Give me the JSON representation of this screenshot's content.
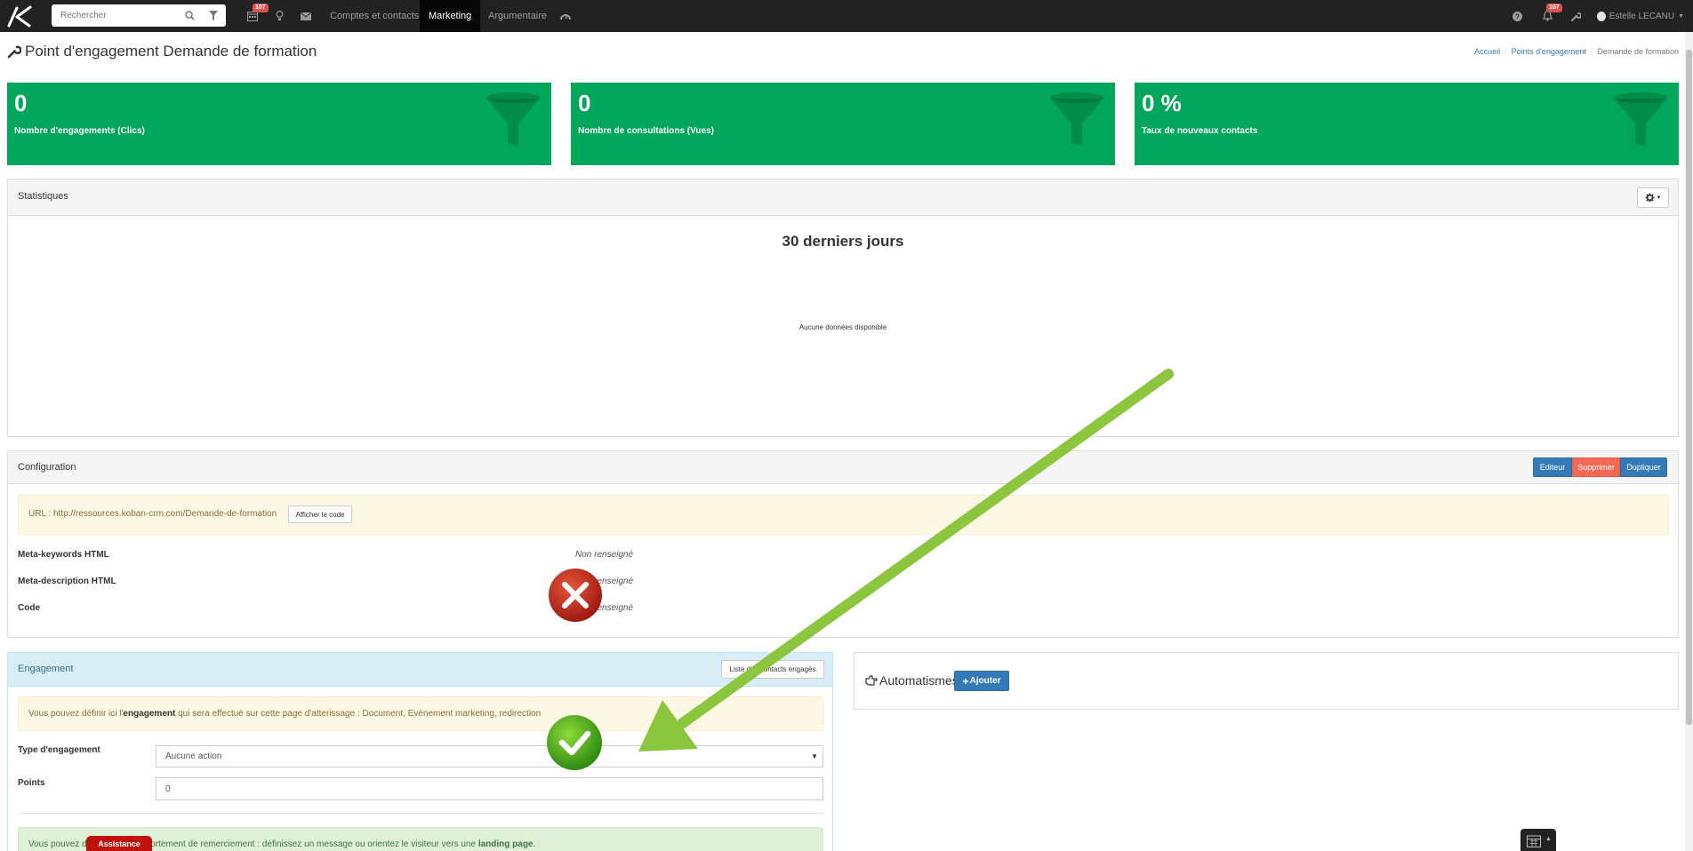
{
  "nav": {
    "search_placeholder": "Rechercher",
    "calendar_badge": "107",
    "notif_badge": "107",
    "links": [
      "Comptes et contacts",
      "Marketing",
      "Argumentaire"
    ],
    "user": "Estelle LECANU"
  },
  "header": {
    "title": "Point d'engagement Demande de formation",
    "breadcrumb": [
      "Accueil",
      "Points d'engagement",
      "Demande de formation"
    ]
  },
  "stats": [
    {
      "value": "0",
      "label": "Nombre d'engagements (Clics)"
    },
    {
      "value": "0",
      "label": "Nombre de consultations (Vues)"
    },
    {
      "value": "0 %",
      "label": "Taux de nouveaux contacts"
    }
  ],
  "statistics": {
    "title": "Statistiques",
    "chart_title": "30 derniers jours",
    "no_data": "Aucune données disponible"
  },
  "configuration": {
    "title": "Configuration",
    "buttons": {
      "edit": "Editeur",
      "delete": "Supprimer",
      "duplicate": "Dupliquer"
    },
    "url": "URL : http://ressources.koban-crm.com/Demande-de-formation",
    "show_code": "Afficher le code",
    "fields": [
      {
        "label": "Meta-keywords HTML",
        "value": "Non renseigné"
      },
      {
        "label": "Meta-description HTML",
        "value": "Non renseigné"
      },
      {
        "label": "Code",
        "value": "Non renseigné"
      }
    ]
  },
  "engagement": {
    "title": "Engagement",
    "list_button": "Liste des contacts engagés",
    "info_pre": "Vous pouvez définir ici l'",
    "info_bold": "engagement",
    "info_post": " qui sera effectué sur cette page d'atterissage : Document, Evènement marketing, redirection",
    "type_label": "Type d'engagement",
    "type_value": "Aucune action",
    "points_label": "Points",
    "points_value": "0",
    "success_pre": "Vous pouvez définir ici le comportement de remerciement : définissez un message ou orientez le visiteur vers une ",
    "success_bold": "landing page",
    "success_post": "."
  },
  "automatismes": {
    "title": "Automatismes",
    "add_button": "Ajouter"
  },
  "assistance": "Assistance",
  "colors": {
    "navbar": "#222222",
    "stat_green": "#00a65a",
    "primary_blue": "#337ab7",
    "danger_red": "#f56954",
    "arrow_green": "#8cc63f"
  }
}
